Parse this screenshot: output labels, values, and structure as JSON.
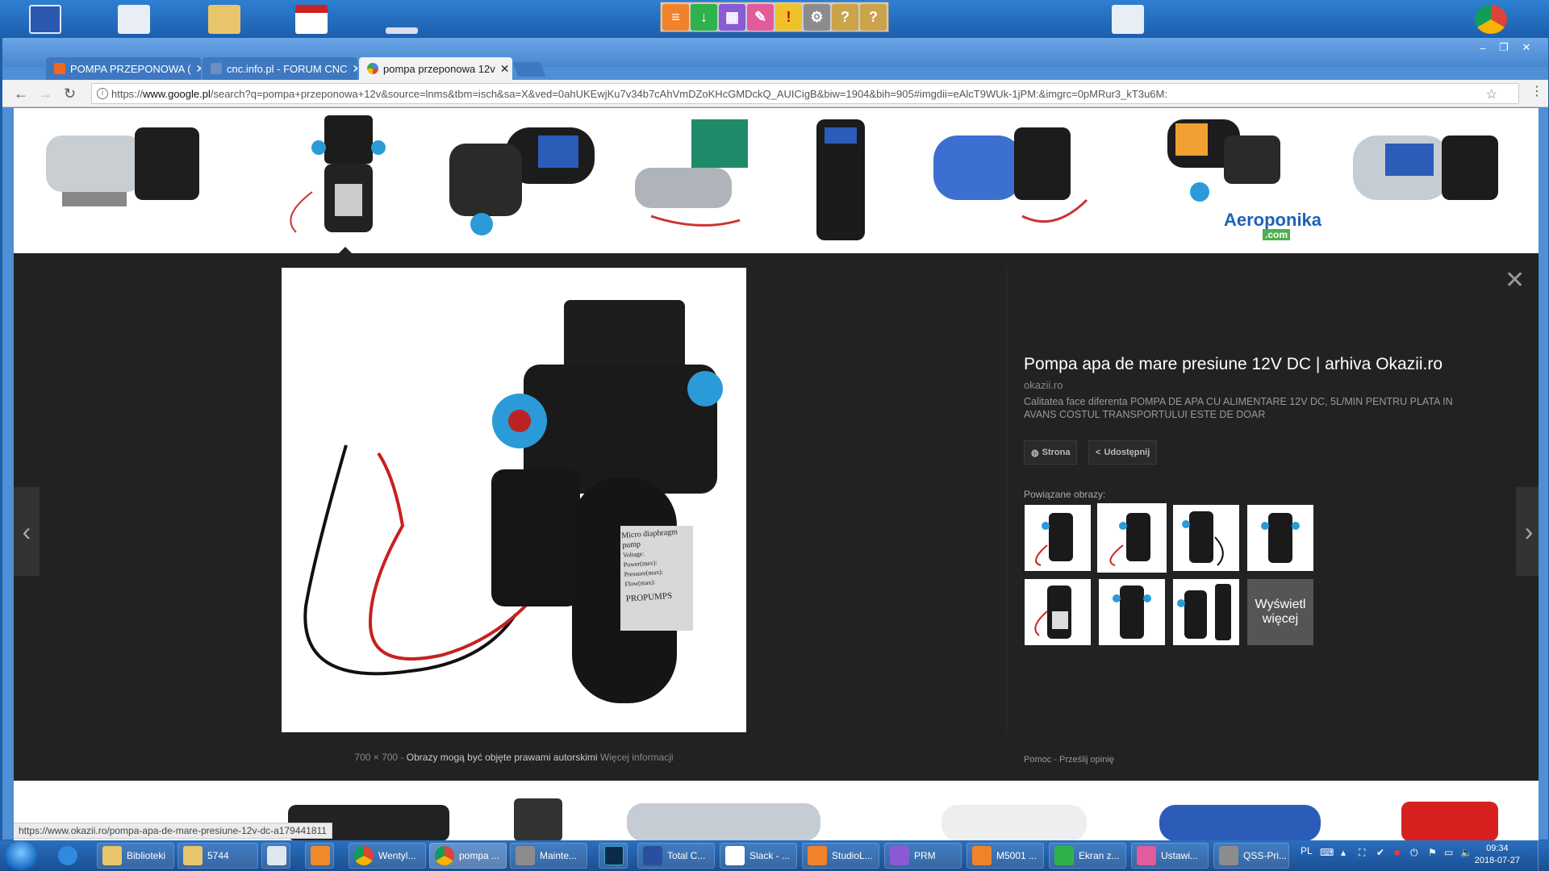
{
  "browser": {
    "tabs": [
      {
        "label": "POMPA PRZEPONOWA (",
        "active": false
      },
      {
        "label": "cnc.info.pl - FORUM CNC",
        "active": false
      },
      {
        "label": "pompa przeponowa 12v",
        "active": true
      }
    ],
    "url_prefix": "https://",
    "url_domain": "www.google.pl",
    "url_rest": "/search?q=pompa+przeponowa+12v&source=lnms&tbm=isch&sa=X&ved=0ahUKEwjKu7v34b7cAhVmDZoKHcGMDckQ_AUICigB&biw=1904&bih=905#imgdii=eAlcT9WUk-1jPM:&imgrc=0pMRur3_kT3u6M:",
    "status_url": "https://www.okazii.ro/pompa-apa-de-mare-presiune-12v-dc-a179441811"
  },
  "viewer": {
    "image_meta_size": "700 × 700",
    "image_meta_copyright": "Obrazy mogą być objęte prawami autorskimi",
    "image_meta_more": "Więcej informacji",
    "title": "Pompa apa de mare presiune 12V DC | arhiva Okazii.ro",
    "site": "okazii.ro",
    "description": "Calitatea face diferenta POMPA DE APA CU ALIMENTARE 12V DC, 5L/MIN PENTRU PLATA IN AVANS COSTUL TRANSPORTULUI ESTE DE DOAR",
    "btn_visit": "Strona",
    "btn_share": "Udostępnij",
    "related_label": "Powiązane obrazy:",
    "more_label": "Wyświetl więcej",
    "help_link": "Pomoc",
    "feedback_link": "Prześlij opinię",
    "sep": "-",
    "pump_label_lines": [
      "Micro diaphragm pump",
      "Voltage:",
      "Power(max):",
      "Pressure(max):",
      "Flow(max):",
      "PROPUMPS"
    ]
  },
  "thumbs_brand": "Aeroponika",
  "thumbs_brand_sub": ".com",
  "taskbar": {
    "items": [
      {
        "label": "Biblioteki"
      },
      {
        "label": "5744"
      },
      {
        "label": ""
      },
      {
        "label": ""
      },
      {
        "label": "Wentyl..."
      },
      {
        "label": "pompa ..."
      },
      {
        "label": "Mainte..."
      },
      {
        "label": ""
      },
      {
        "label": "Total C..."
      },
      {
        "label": "Slack - ..."
      },
      {
        "label": "StudioL..."
      },
      {
        "label": "PRM"
      },
      {
        "label": "M5001 ..."
      },
      {
        "label": "Ekran z..."
      },
      {
        "label": "Ustawi..."
      },
      {
        "label": "QSS-Pri..."
      }
    ],
    "lang": "PL",
    "time": "09:34",
    "date": "2018-07-27"
  },
  "colors": {
    "accent_blue": "#1a73e8",
    "panel_bg": "#222222"
  }
}
